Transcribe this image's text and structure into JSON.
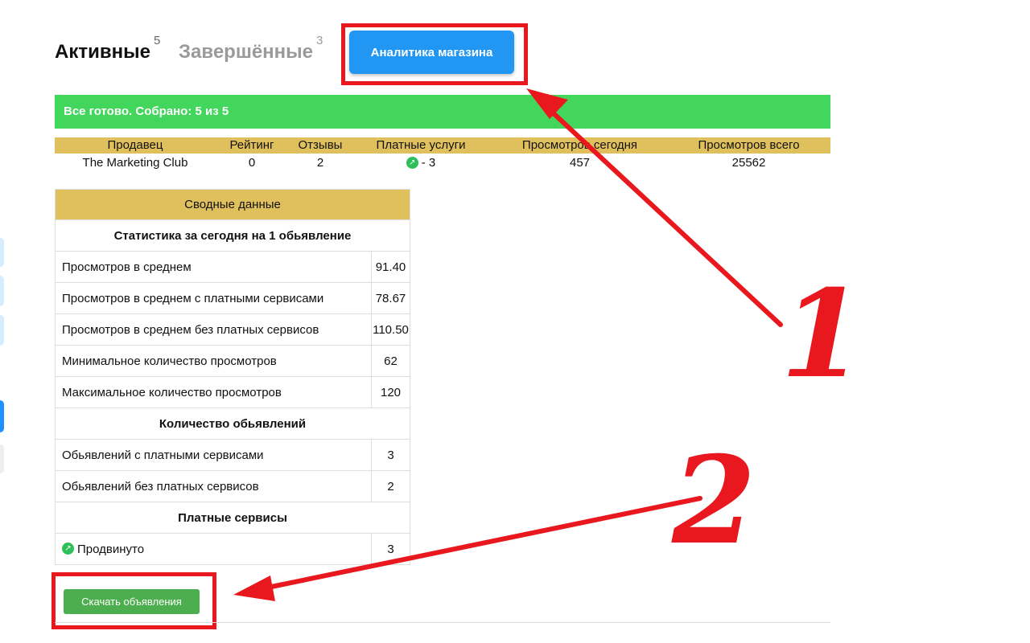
{
  "tabs": {
    "active": {
      "label": "Активные",
      "count": "5"
    },
    "completed": {
      "label": "Завершённые",
      "count": "3"
    }
  },
  "analytics_button": "Аналитика магазина",
  "status_text": "Все готово. Собрано: 5 из 5",
  "seller_table": {
    "headers": [
      "Продавец",
      "Рейтинг",
      "Отзывы",
      "Платные услуги",
      "Просмотров сегодня",
      "Просмотров всего"
    ],
    "row": {
      "seller": "The Marketing Club",
      "rating": "0",
      "reviews": "2",
      "paid_services": "- 3",
      "views_today": "457",
      "views_total": "25562"
    }
  },
  "summary": {
    "title": "Сводные данные",
    "sections": [
      {
        "heading": "Статистика за сегодня на 1 обьявление",
        "rows": [
          {
            "label": "Просмотров в среднем",
            "value": "91.40"
          },
          {
            "label": "Просмотров в среднем с платными сервисами",
            "value": "78.67"
          },
          {
            "label": "Просмотров в среднем без платных сервисов",
            "value": "110.50"
          },
          {
            "label": "Минимальное количество просмотров",
            "value": "62"
          },
          {
            "label": "Максимальное количество просмотров",
            "value": "120"
          }
        ]
      },
      {
        "heading": "Количество обьявлений",
        "rows": [
          {
            "label": "Обьявлений с платными сервисами",
            "value": "3"
          },
          {
            "label": "Обьявлений без платных сервисов",
            "value": "2"
          }
        ]
      },
      {
        "heading": "Платные сервисы",
        "rows": [
          {
            "label": "Продвинуто",
            "value": "3",
            "icon": "promote-arrow-icon"
          }
        ]
      }
    ]
  },
  "download_button": "Скачать объявления",
  "annotations": {
    "marker1": "1",
    "marker2": "2",
    "color": "#e8181e"
  },
  "colors": {
    "accent_blue": "#2296f3",
    "status_green": "#42d65c",
    "header_gold": "#e0c05c",
    "button_green": "#4cae4f"
  }
}
